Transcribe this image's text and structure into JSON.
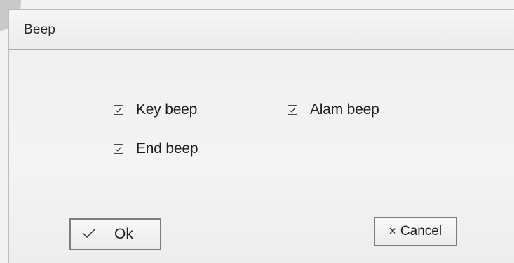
{
  "dialog": {
    "title": "Beep"
  },
  "options": [
    {
      "label": "Key beep",
      "checked": true
    },
    {
      "label": "Alam beep",
      "checked": true
    },
    {
      "label": "End beep",
      "checked": true
    }
  ],
  "buttons": {
    "ok": {
      "label": "Ok",
      "icon": "check-icon"
    },
    "cancel": {
      "label": "Cancel",
      "icon": "close-icon"
    }
  }
}
